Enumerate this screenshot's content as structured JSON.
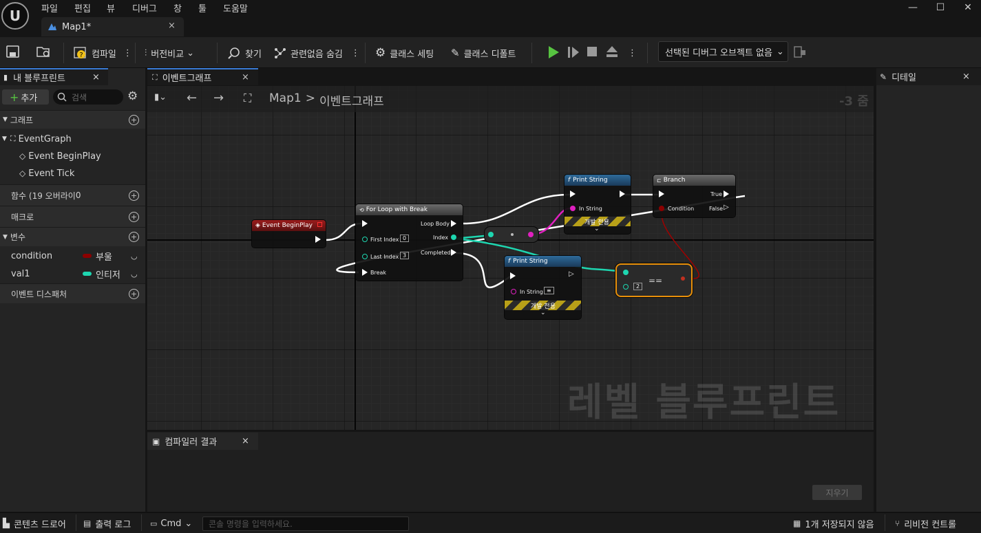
{
  "menu": [
    "파일",
    "편집",
    "뷰",
    "디버그",
    "창",
    "툴",
    "도움말"
  ],
  "document_tab": {
    "label": "Map1*",
    "close": "×"
  },
  "window_controls": {
    "minimize": "—",
    "maximize": "☐",
    "close": "✕"
  },
  "toolbar": {
    "compile": "컴파일",
    "diff": "버전비교",
    "find": "찾기",
    "hide_unrelated": "관련없음 숨김",
    "class_settings": "클래스 세팅",
    "class_defaults": "클래스 디폴트",
    "debug_object": "선택된 디버그 오브젝트 없음"
  },
  "my_blueprint": {
    "tab_label": "내 블루프린트",
    "add_label": "추가",
    "search_placeholder": "검색",
    "graphs_label": "그래프",
    "event_graph": "EventGraph",
    "events": [
      "Event BeginPlay",
      "Event Tick"
    ],
    "functions_label": "함수 (19 오버라이",
    "functions_count": "0",
    "macros_label": "매크로",
    "variables_label": "변수",
    "variables": [
      {
        "name": "condition",
        "type": "부울",
        "color": "#8c0000"
      },
      {
        "name": "val1",
        "type": "인티저",
        "color": "#1ed6b0"
      }
    ],
    "dispatchers_label": "이벤트 디스패처"
  },
  "graph_tab": {
    "label": "이벤트그래프",
    "close": "×"
  },
  "breadcrumb": {
    "root": "Map1",
    "separator": ">",
    "current": "이벤트그래프"
  },
  "zoom": "-3 줌",
  "watermark": "레벨 블루프린트",
  "nodes": {
    "begin_play": {
      "title": "Event BeginPlay"
    },
    "for_loop": {
      "title": "For Loop with Break",
      "loop_body": "Loop Body",
      "first_index": "First Index",
      "first_value": "0",
      "index": "Index",
      "last_index": "Last Index",
      "last_value": "3",
      "completed": "Completed",
      "break": "Break"
    },
    "print1": {
      "title": "Print String",
      "in_string": "In String",
      "dev_only": "개발 전용"
    },
    "print2": {
      "title": "Print String",
      "in_string": "In String",
      "in_value": "≡",
      "dev_only": "개발 전용"
    },
    "branch": {
      "title": "Branch",
      "true": "True",
      "condition": "Condition",
      "false": "False"
    },
    "equals": {
      "op": "==",
      "value": "2"
    }
  },
  "details": {
    "tab_label": "디테일",
    "close": "×"
  },
  "compiler": {
    "tab_label": "컴파일러 결과",
    "close": "×",
    "clear_label": "지우기"
  },
  "statusbar": {
    "content_drawer": "콘텐츠 드로어",
    "output_log": "출력 로그",
    "cmd": "Cmd",
    "console_placeholder": "콘솔 명령을 입력하세요.",
    "unsaved": "1개 저장되지 않음",
    "revision_control": "리비전 컨트롤"
  }
}
